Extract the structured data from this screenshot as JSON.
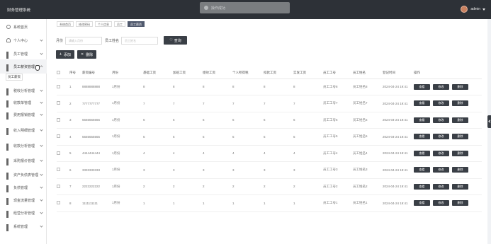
{
  "app": {
    "title": "财务管理系统"
  },
  "toast": {
    "text": "操作成功"
  },
  "user": {
    "name": "admin"
  },
  "sidebar": {
    "items": [
      {
        "label": "系统首页",
        "icon": "home-icon"
      },
      {
        "label": "个人中心",
        "icon": "user-icon"
      },
      {
        "label": "员工管理",
        "icon": "grid-icon"
      },
      {
        "label": "员工薪资管理",
        "icon": "grid-icon"
      },
      {
        "label": "税收分析管理",
        "icon": "grid-icon"
      },
      {
        "label": "收款单管理",
        "icon": "grid-icon"
      },
      {
        "label": "费用报销管理",
        "icon": "grid-icon"
      },
      {
        "label": "收入明细管理",
        "icon": "grid-icon"
      },
      {
        "label": "收款分析管理",
        "icon": "grid-icon"
      },
      {
        "label": "采购报价管理",
        "icon": "grid-icon"
      },
      {
        "label": "资产负债表管理",
        "icon": "grid-icon"
      },
      {
        "label": "负债管理",
        "icon": "grid-icon"
      },
      {
        "label": "现金流量管理",
        "icon": "grid-icon"
      },
      {
        "label": "经营分析管理",
        "icon": "grid-icon"
      },
      {
        "label": "系统管理",
        "icon": "grid-icon"
      }
    ],
    "sub_item": "员工薪资"
  },
  "breadcrumb": [
    "系统首页",
    "修改密码",
    "个人信息",
    "员工",
    "员工薪资"
  ],
  "search": {
    "label1": "月份",
    "placeholder1": "请输入月份",
    "label2": "员工姓名",
    "placeholder2": "员工姓名",
    "query_label": "查询"
  },
  "actions": {
    "add_label": "添加",
    "delete_label": "删除"
  },
  "table": {
    "headers": [
      "序号",
      "薪资编号",
      "月份",
      "基础工资",
      "加班工资",
      "绩效工资",
      "个人所得税",
      "扣款工资",
      "实发工资",
      "员工工号",
      "员工姓名",
      "登记时间",
      "操作"
    ],
    "ops": [
      "查看",
      "修改",
      "删除"
    ],
    "rows": [
      [
        "1",
        "8888888888",
        "1月份",
        "8",
        "8",
        "8",
        "8",
        "8",
        "8",
        "员工工号8",
        "员工姓名8",
        "2024-04-24 19:41"
      ],
      [
        "2",
        "7777777777",
        "1月份",
        "7",
        "7",
        "7",
        "7",
        "7",
        "7",
        "员工工号7",
        "员工姓名7",
        "2024-04-24 19:41"
      ],
      [
        "3",
        "6666666666",
        "1月份",
        "6",
        "6",
        "6",
        "6",
        "6",
        "6",
        "员工工号6",
        "员工姓名6",
        "2024-04-24 19:41"
      ],
      [
        "4",
        "5555555555",
        "1月份",
        "5",
        "5",
        "5",
        "5",
        "5",
        "5",
        "员工工号5",
        "员工姓名5",
        "2024-04-24 19:41"
      ],
      [
        "5",
        "4444444444",
        "1月份",
        "4",
        "4",
        "4",
        "4",
        "4",
        "4",
        "员工工号4",
        "员工姓名4",
        "2024-04-24 19:41"
      ],
      [
        "6",
        "3333333333",
        "1月份",
        "3",
        "3",
        "3",
        "3",
        "3",
        "3",
        "员工工号3",
        "员工姓名3",
        "2024-04-24 19:41"
      ],
      [
        "7",
        "2222222222",
        "1月份",
        "2",
        "2",
        "2",
        "2",
        "2",
        "2",
        "员工工号2",
        "员工姓名2",
        "2024-04-24 19:41"
      ],
      [
        "8",
        "1111111111",
        "1月份",
        "1",
        "1",
        "1",
        "1",
        "1",
        "1",
        "员工工号1",
        "员工姓名1",
        "2024-04-24 19:41"
      ]
    ]
  }
}
